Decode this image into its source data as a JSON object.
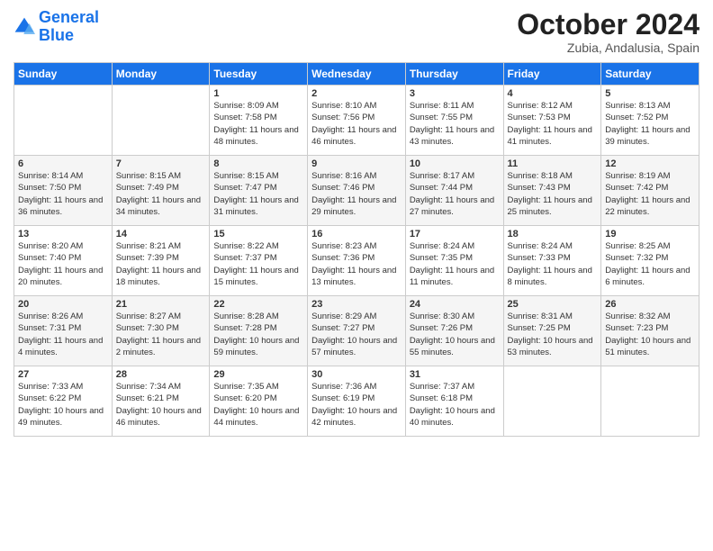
{
  "header": {
    "logo_line1": "General",
    "logo_line2": "Blue",
    "month_title": "October 2024",
    "location": "Zubia, Andalusia, Spain"
  },
  "days_of_week": [
    "Sunday",
    "Monday",
    "Tuesday",
    "Wednesday",
    "Thursday",
    "Friday",
    "Saturday"
  ],
  "weeks": [
    [
      {
        "day": "",
        "info": ""
      },
      {
        "day": "",
        "info": ""
      },
      {
        "day": "1",
        "info": "Sunrise: 8:09 AM\nSunset: 7:58 PM\nDaylight: 11 hours and 48 minutes."
      },
      {
        "day": "2",
        "info": "Sunrise: 8:10 AM\nSunset: 7:56 PM\nDaylight: 11 hours and 46 minutes."
      },
      {
        "day": "3",
        "info": "Sunrise: 8:11 AM\nSunset: 7:55 PM\nDaylight: 11 hours and 43 minutes."
      },
      {
        "day": "4",
        "info": "Sunrise: 8:12 AM\nSunset: 7:53 PM\nDaylight: 11 hours and 41 minutes."
      },
      {
        "day": "5",
        "info": "Sunrise: 8:13 AM\nSunset: 7:52 PM\nDaylight: 11 hours and 39 minutes."
      }
    ],
    [
      {
        "day": "6",
        "info": "Sunrise: 8:14 AM\nSunset: 7:50 PM\nDaylight: 11 hours and 36 minutes."
      },
      {
        "day": "7",
        "info": "Sunrise: 8:15 AM\nSunset: 7:49 PM\nDaylight: 11 hours and 34 minutes."
      },
      {
        "day": "8",
        "info": "Sunrise: 8:15 AM\nSunset: 7:47 PM\nDaylight: 11 hours and 31 minutes."
      },
      {
        "day": "9",
        "info": "Sunrise: 8:16 AM\nSunset: 7:46 PM\nDaylight: 11 hours and 29 minutes."
      },
      {
        "day": "10",
        "info": "Sunrise: 8:17 AM\nSunset: 7:44 PM\nDaylight: 11 hours and 27 minutes."
      },
      {
        "day": "11",
        "info": "Sunrise: 8:18 AM\nSunset: 7:43 PM\nDaylight: 11 hours and 25 minutes."
      },
      {
        "day": "12",
        "info": "Sunrise: 8:19 AM\nSunset: 7:42 PM\nDaylight: 11 hours and 22 minutes."
      }
    ],
    [
      {
        "day": "13",
        "info": "Sunrise: 8:20 AM\nSunset: 7:40 PM\nDaylight: 11 hours and 20 minutes."
      },
      {
        "day": "14",
        "info": "Sunrise: 8:21 AM\nSunset: 7:39 PM\nDaylight: 11 hours and 18 minutes."
      },
      {
        "day": "15",
        "info": "Sunrise: 8:22 AM\nSunset: 7:37 PM\nDaylight: 11 hours and 15 minutes."
      },
      {
        "day": "16",
        "info": "Sunrise: 8:23 AM\nSunset: 7:36 PM\nDaylight: 11 hours and 13 minutes."
      },
      {
        "day": "17",
        "info": "Sunrise: 8:24 AM\nSunset: 7:35 PM\nDaylight: 11 hours and 11 minutes."
      },
      {
        "day": "18",
        "info": "Sunrise: 8:24 AM\nSunset: 7:33 PM\nDaylight: 11 hours and 8 minutes."
      },
      {
        "day": "19",
        "info": "Sunrise: 8:25 AM\nSunset: 7:32 PM\nDaylight: 11 hours and 6 minutes."
      }
    ],
    [
      {
        "day": "20",
        "info": "Sunrise: 8:26 AM\nSunset: 7:31 PM\nDaylight: 11 hours and 4 minutes."
      },
      {
        "day": "21",
        "info": "Sunrise: 8:27 AM\nSunset: 7:30 PM\nDaylight: 11 hours and 2 minutes."
      },
      {
        "day": "22",
        "info": "Sunrise: 8:28 AM\nSunset: 7:28 PM\nDaylight: 10 hours and 59 minutes."
      },
      {
        "day": "23",
        "info": "Sunrise: 8:29 AM\nSunset: 7:27 PM\nDaylight: 10 hours and 57 minutes."
      },
      {
        "day": "24",
        "info": "Sunrise: 8:30 AM\nSunset: 7:26 PM\nDaylight: 10 hours and 55 minutes."
      },
      {
        "day": "25",
        "info": "Sunrise: 8:31 AM\nSunset: 7:25 PM\nDaylight: 10 hours and 53 minutes."
      },
      {
        "day": "26",
        "info": "Sunrise: 8:32 AM\nSunset: 7:23 PM\nDaylight: 10 hours and 51 minutes."
      }
    ],
    [
      {
        "day": "27",
        "info": "Sunrise: 7:33 AM\nSunset: 6:22 PM\nDaylight: 10 hours and 49 minutes."
      },
      {
        "day": "28",
        "info": "Sunrise: 7:34 AM\nSunset: 6:21 PM\nDaylight: 10 hours and 46 minutes."
      },
      {
        "day": "29",
        "info": "Sunrise: 7:35 AM\nSunset: 6:20 PM\nDaylight: 10 hours and 44 minutes."
      },
      {
        "day": "30",
        "info": "Sunrise: 7:36 AM\nSunset: 6:19 PM\nDaylight: 10 hours and 42 minutes."
      },
      {
        "day": "31",
        "info": "Sunrise: 7:37 AM\nSunset: 6:18 PM\nDaylight: 10 hours and 40 minutes."
      },
      {
        "day": "",
        "info": ""
      },
      {
        "day": "",
        "info": ""
      }
    ]
  ]
}
